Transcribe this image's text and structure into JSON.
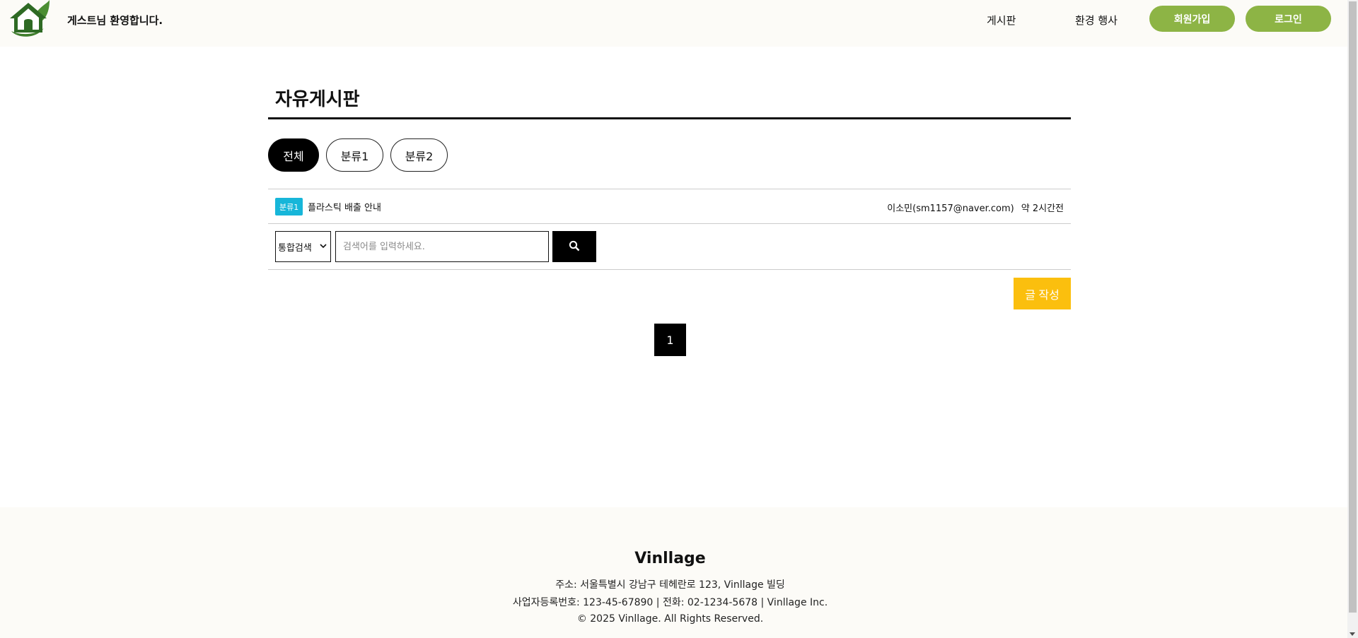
{
  "header": {
    "welcome": "게스트님 환영합니다.",
    "nav": {
      "board": "게시판",
      "event": "환경 행사"
    },
    "signup_label": "회원가입",
    "login_label": "로그인"
  },
  "board": {
    "title": "자유게시판",
    "tabs": {
      "all": "전체",
      "cat1": "분류1",
      "cat2": "분류2"
    }
  },
  "posts": [
    {
      "badge": "분류1",
      "title": "플라스틱 배출 안내",
      "author": "이소민(sm1157@naver.com)",
      "time": "약 2시간전"
    }
  ],
  "search": {
    "type_selected": "통합검색",
    "placeholder": "검색어를 입력하세요."
  },
  "write_label": "글 작성",
  "pagination": {
    "current": "1"
  },
  "footer": {
    "brand": "Vinllage",
    "address": "주소: 서울특별시 강남구 테헤란로 123, Vinllage 빌딩",
    "business": "사업자등록번호: 123-45-67890 | 전화: 02-1234-5678 | Vinllage Inc.",
    "copyright": "© 2025 Vinllage. All Rights Reserved."
  },
  "colors": {
    "accent_green": "#8db445",
    "badge_cyan": "#17b6d9",
    "write_yellow": "#fbbf0e",
    "header_bg": "#fcfbf7"
  },
  "icons": {
    "logo": "house-leaf-logo",
    "search": "search-icon",
    "select": "chevron-down-icon"
  }
}
